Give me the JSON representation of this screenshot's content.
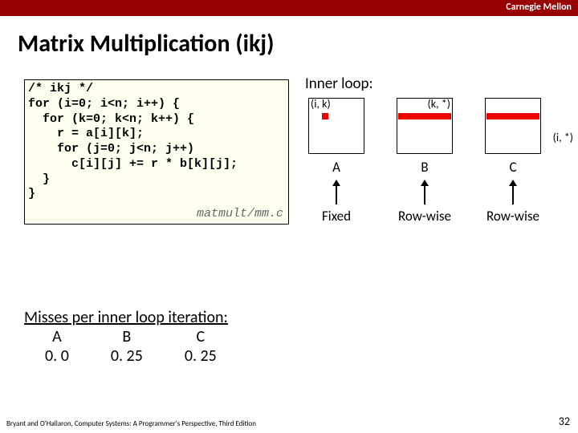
{
  "brand": "Carnegie Mellon",
  "title": "Matrix Multiplication (ikj)",
  "code": "/* ikj */\nfor (i=0; i<n; i++) {\n  for (k=0; k<n; k++) {\n    r = a[i][k];\n    for (j=0; j<n; j++)\n      c[i][j] += r * b[k][j];\n  }\n}",
  "code_file": "matmult/mm.c",
  "diagram": {
    "title": "Inner loop:",
    "A": {
      "coord": "(i, k)",
      "name": "A",
      "mode": "Fixed"
    },
    "B": {
      "coord": "(k, *)",
      "name": "B",
      "mode": "Row-wise"
    },
    "C": {
      "coord": "(i, *)",
      "name": "C",
      "mode": "Row-wise"
    }
  },
  "misses": {
    "heading": "Misses per inner loop iteration:",
    "cols": {
      "A": "A",
      "B": "B",
      "C": "C"
    },
    "vals": {
      "A": "0. 0",
      "B": "0. 25",
      "C": "0. 25"
    }
  },
  "footer": "Bryant and O'Hallaron, Computer Systems: A Programmer's Perspective, Third Edition",
  "page": "32"
}
